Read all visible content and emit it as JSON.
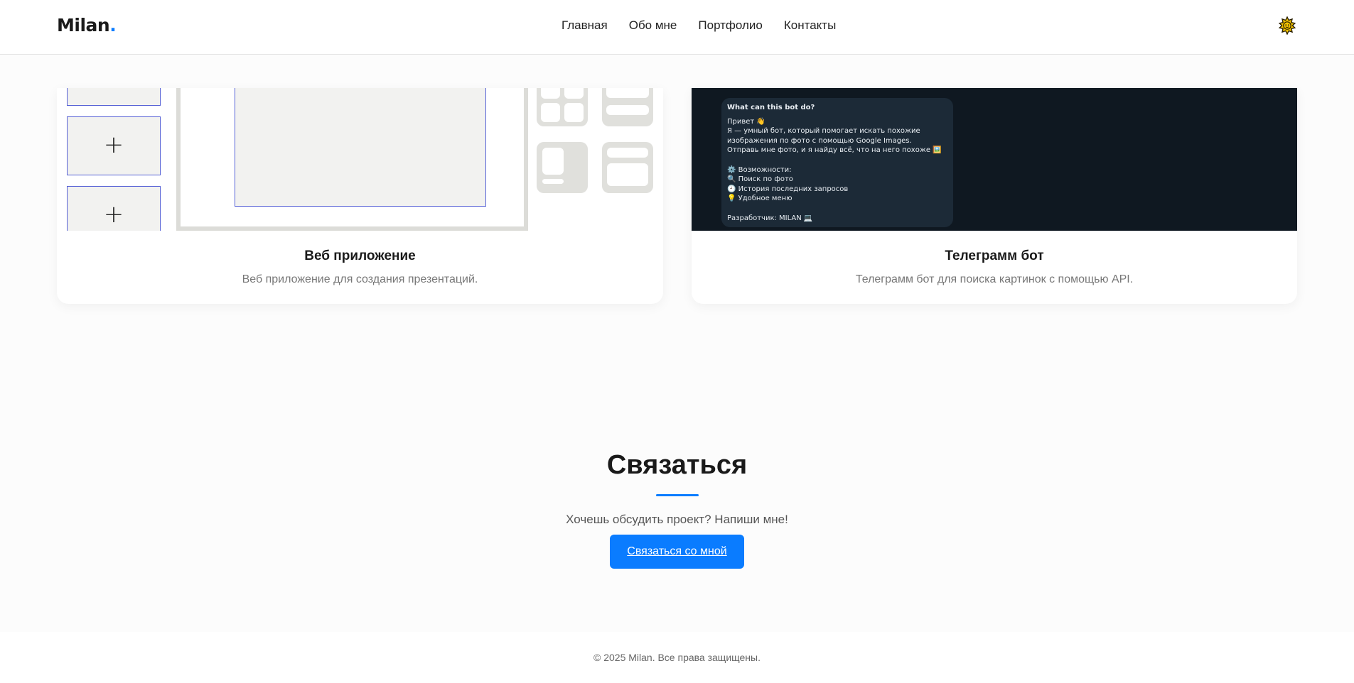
{
  "header": {
    "logo_text": "Milan",
    "logo_dot": ".",
    "nav": [
      "Главная",
      "Обо мне",
      "Портфолио",
      "Контакты"
    ],
    "theme_icon": "sun-icon"
  },
  "portfolio": {
    "cards": [
      {
        "title": "Веб приложение",
        "description": "Веб приложение для создания презентаций.",
        "preview": {
          "plus_1": "+",
          "plus_2": "+"
        }
      },
      {
        "title": "Телеграмм бот",
        "description": "Телеграмм бот для поиска картинок с помощью API.",
        "preview": {
          "question": "What can this bot do?",
          "greeting": "Привет 👋",
          "line1": "Я — умный бот, который помогает искать похожие",
          "line2": "изображения по фото с помощью Google Images.",
          "line3": "Отправь мне фото, и я найду всё, что на него похоже 🖼️",
          "features_title": "⚙️ Возможности:",
          "feature1": "🔍 Поиск по фото",
          "feature2": "🕘 История последних запросов",
          "feature3": "💡 Удобное меню",
          "developer": "Разработчик: MILAN 💻"
        }
      }
    ]
  },
  "contact": {
    "title": "Связаться",
    "text": "Хочешь обсудить проект? Напиши мне!",
    "button": "Связаться со мной"
  },
  "footer": {
    "text": "© 2025 Milan. Все права защищены."
  },
  "colors": {
    "accent": "#0a7cff",
    "telegram_bg": "#0f1821"
  }
}
